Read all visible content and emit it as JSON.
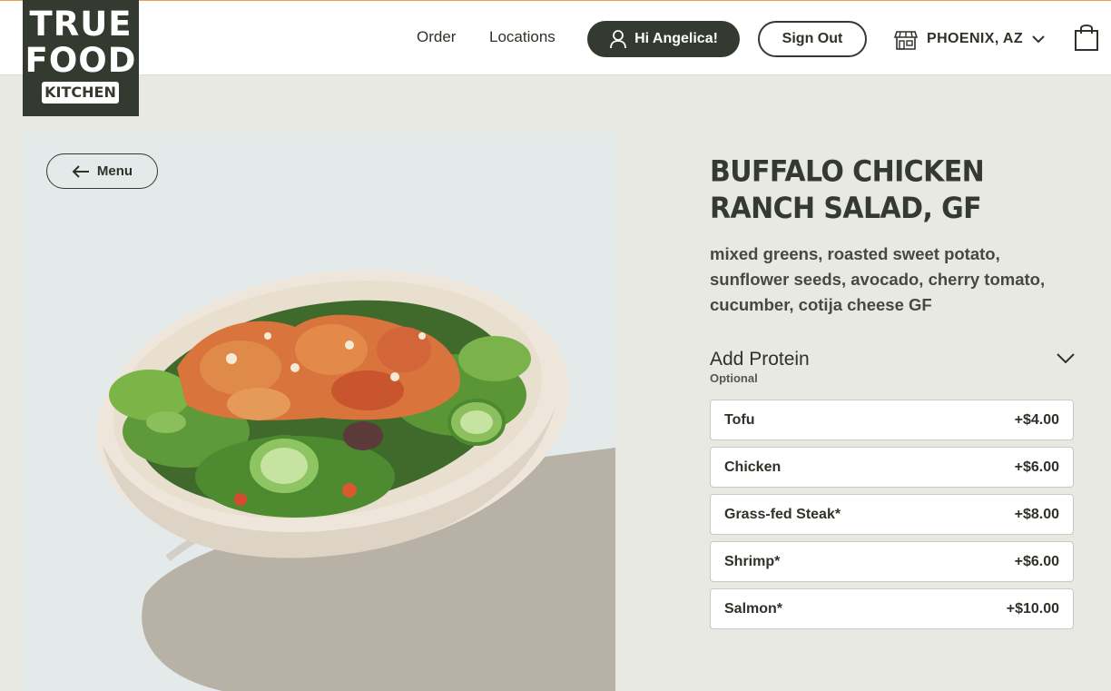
{
  "brand": {
    "line1": "TRUE",
    "line2": "FOOD",
    "line3": "KITCHEN"
  },
  "nav": {
    "order": "Order",
    "locations": "Locations",
    "greeting": "Hi Angelica!",
    "sign_out": "Sign Out",
    "location": "PHOENIX, AZ"
  },
  "back": {
    "label": "Menu"
  },
  "item": {
    "title": "BUFFALO CHICKEN RANCH SALAD, GF",
    "description": "mixed greens, roasted sweet potato, sunflower seeds, avocado, cherry tomato, cucumber, cotija cheese GF"
  },
  "protein": {
    "heading": "Add Protein",
    "sub": "Optional",
    "options": [
      {
        "name": "Tofu",
        "price": "+$4.00"
      },
      {
        "name": "Chicken",
        "price": "+$6.00"
      },
      {
        "name": "Grass-fed Steak*",
        "price": "+$8.00"
      },
      {
        "name": "Shrimp*",
        "price": "+$6.00"
      },
      {
        "name": "Salmon*",
        "price": "+$10.00"
      }
    ]
  },
  "icons": {
    "user": "user-icon",
    "store": "store-icon",
    "chevron": "chevron-down-icon",
    "bag": "shopping-bag-icon",
    "arrow": "arrow-left-icon"
  },
  "colors": {
    "brand_dark": "#343a30",
    "background": "#e9e9e4",
    "accent_line": "#e8a24a"
  }
}
